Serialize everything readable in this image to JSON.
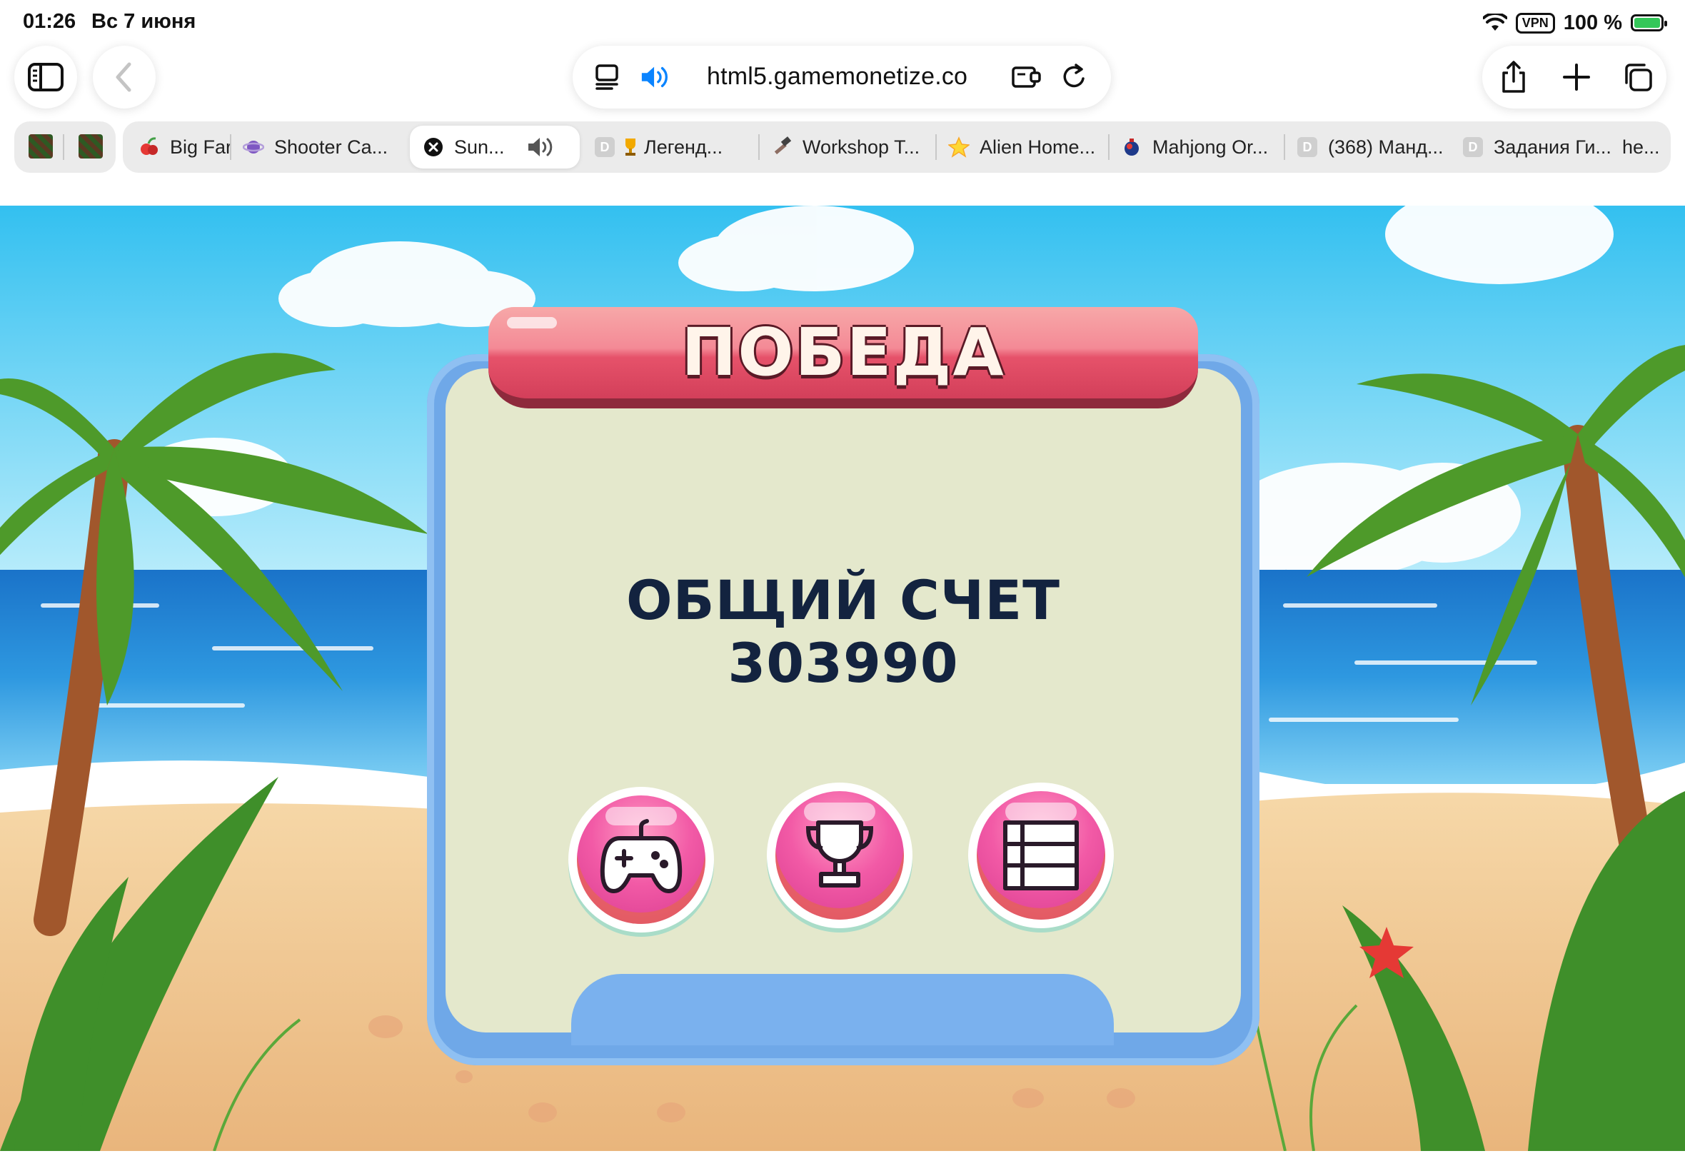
{
  "status_bar": {
    "time": "01:26",
    "date": "Вс 7 июня",
    "vpn": "VPN",
    "battery": "100 %",
    "icons": [
      "wifi-icon",
      "battery-charging-icon"
    ]
  },
  "toolbar": {
    "url": "html5.gamemonetize.co",
    "icons": [
      "sidebar-icon",
      "back-icon",
      "reader-icon",
      "speaker-icon",
      "extensions-icon",
      "reload-icon",
      "share-icon",
      "new-tab-icon",
      "tabs-overview-icon"
    ]
  },
  "tabs": [
    {
      "title": "Big Far",
      "favicon": "fruit-icon"
    },
    {
      "title": "Shooter Ca...",
      "favicon": "planet-icon"
    },
    {
      "title": "Sun...",
      "favicon": "close-icon",
      "active": true,
      "audio": "speaker-icon"
    },
    {
      "title": "Легенд...",
      "favicon": "trophy-icon"
    },
    {
      "title": "Workshop T...",
      "favicon": "hammer-icon"
    },
    {
      "title": "Alien Home...",
      "favicon": "star-icon"
    },
    {
      "title": "Mahjong Or...",
      "favicon": "ornament-icon"
    },
    {
      "title": "(368) Манд...",
      "favicon": "d-icon"
    },
    {
      "title": "Задания Ги...",
      "favicon": "d-icon"
    },
    {
      "title": "he...",
      "favicon": ""
    }
  ],
  "tab_favicon_letter": "D",
  "game": {
    "banner_title": "ПОБЕДА",
    "score_label": "ОБЩИЙ СЧЕТ",
    "score_value": "303990",
    "buttons": [
      "gamepad-icon",
      "trophy-icon",
      "list-icon"
    ],
    "colors": {
      "banner": "#e6526a",
      "panel": "#e4e8cc",
      "panel_frame": "#6fa8e8",
      "button": "#f25aa6",
      "score_text": "#13233f"
    }
  }
}
